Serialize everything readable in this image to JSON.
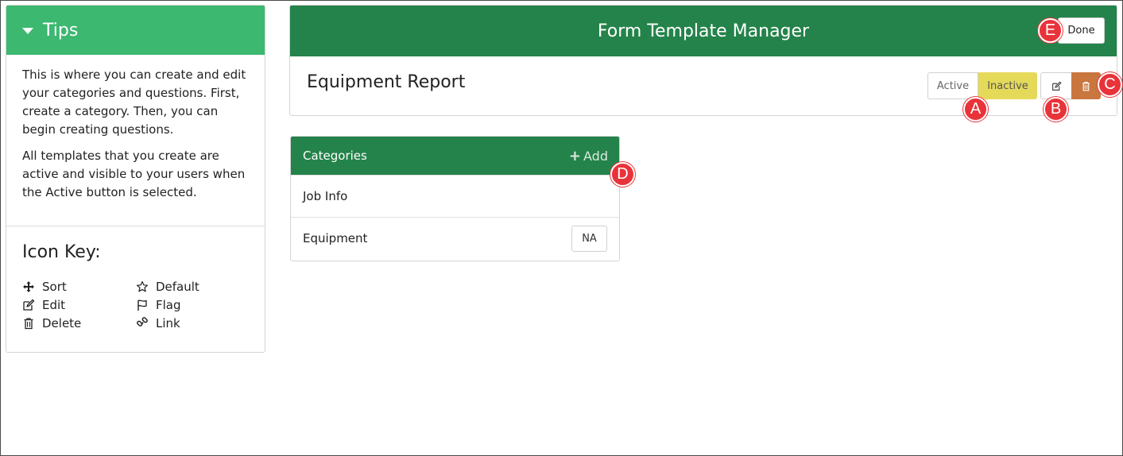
{
  "tips": {
    "title": "Tips",
    "paragraph1": "This is where you can create and edit your categories and questions. First, create a category. Then, you can begin creating questions.",
    "paragraph2": "All templates that you create are active and visible to your users when the Active button is selected.",
    "icon_key_title": "Icon Key:",
    "icon_key": [
      {
        "icon": "sort-icon",
        "label": "Sort"
      },
      {
        "icon": "star-icon",
        "label": "Default"
      },
      {
        "icon": "edit-icon",
        "label": "Edit"
      },
      {
        "icon": "flag-icon",
        "label": "Flag"
      },
      {
        "icon": "trash-icon",
        "label": "Delete"
      },
      {
        "icon": "link-icon",
        "label": "Link"
      }
    ]
  },
  "main": {
    "title": "Form Template Manager",
    "done_label": "Done",
    "template_name": "Equipment Report",
    "status_toggle": {
      "active_label": "Active",
      "inactive_label": "Inactive",
      "selected": "Inactive"
    }
  },
  "categories": {
    "title": "Categories",
    "add_label": "Add",
    "items": [
      {
        "name": "Job Info",
        "badge": ""
      },
      {
        "name": "Equipment",
        "badge": "NA"
      }
    ]
  },
  "markers": [
    "A",
    "B",
    "C",
    "D",
    "E"
  ],
  "colors": {
    "tips_header": "#3cb870",
    "main_header": "#24834a",
    "inactive_selected": "#e5d95a",
    "delete_button": "#c9763f",
    "marker": "#e8333a"
  }
}
